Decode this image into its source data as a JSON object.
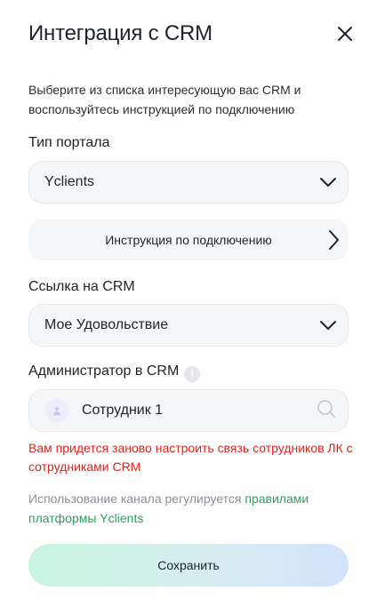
{
  "dialog": {
    "title": "Интеграция с CRM",
    "description": "Выберите из списка интересующую вас CRM и воспользуйтесь инструкцией по подключению"
  },
  "portal_type": {
    "label": "Тип портала",
    "value": "Yclients"
  },
  "instruction": {
    "label": "Инструкция по подключению"
  },
  "crm_link": {
    "label": "Ссылка на CRM",
    "value": "Мое Удовольствие"
  },
  "admin": {
    "label": "Администратор в CRM",
    "value": "Сотрудник 1"
  },
  "warning": "Вам придется заново настроить связь сотрудников ЛК с сотрудниками CRM",
  "note": {
    "prefix": "Использование канала регулируется ",
    "link_text": "правилами платформы Yclients"
  },
  "save_button": "Сохранить",
  "colors": {
    "warning": "#e0231c",
    "link": "#2f9e5c",
    "muted": "#8a8f98",
    "field_bg": "#f5f6f8"
  },
  "icons": [
    "close-icon",
    "chevron-down-icon",
    "chevron-right-icon",
    "info-icon",
    "user-icon",
    "search-icon"
  ]
}
